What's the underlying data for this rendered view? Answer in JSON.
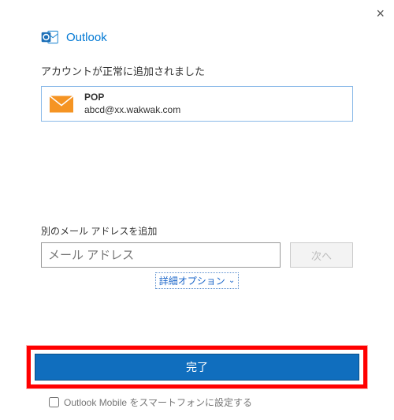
{
  "window": {
    "close_glyph": "×"
  },
  "header": {
    "brand": "Outlook"
  },
  "main": {
    "success_message": "アカウントが正常に追加されました",
    "account": {
      "type_label": "POP",
      "email": "abcd@xx.wakwak.com"
    },
    "add_another": {
      "section_label": "別のメール アドレスを追加",
      "placeholder": "メール アドレス",
      "next_button": "次へ",
      "advanced_label": "詳細オプション"
    },
    "done_button": "完了",
    "mobile_checkbox_label": "Outlook Mobile をスマートフォンに設定する"
  },
  "colors": {
    "accent": "#0078d4",
    "highlight_border": "#ff0000"
  }
}
